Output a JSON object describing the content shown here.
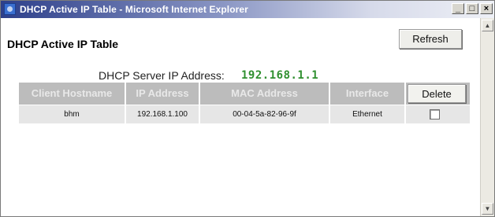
{
  "window": {
    "title": "DHCP Active IP Table - Microsoft Internet Explorer",
    "minimize": "_",
    "maximize": "□",
    "close": "×"
  },
  "page": {
    "title": "DHCP Active IP Table",
    "refresh_label": "Refresh",
    "server_label": "DHCP Server IP Address:",
    "server_ip": "192.168.1.1"
  },
  "table": {
    "headers": [
      "Client Hostname",
      "IP Address",
      "MAC Address",
      "Interface"
    ],
    "delete_label": "Delete",
    "rows": [
      {
        "hostname": "bhm",
        "ip": "192.168.1.100",
        "mac": "00-04-5a-82-96-9f",
        "interface": "Ethernet",
        "delete_checked": false
      }
    ]
  },
  "scrollbar": {
    "up": "▲",
    "down": "▼"
  }
}
